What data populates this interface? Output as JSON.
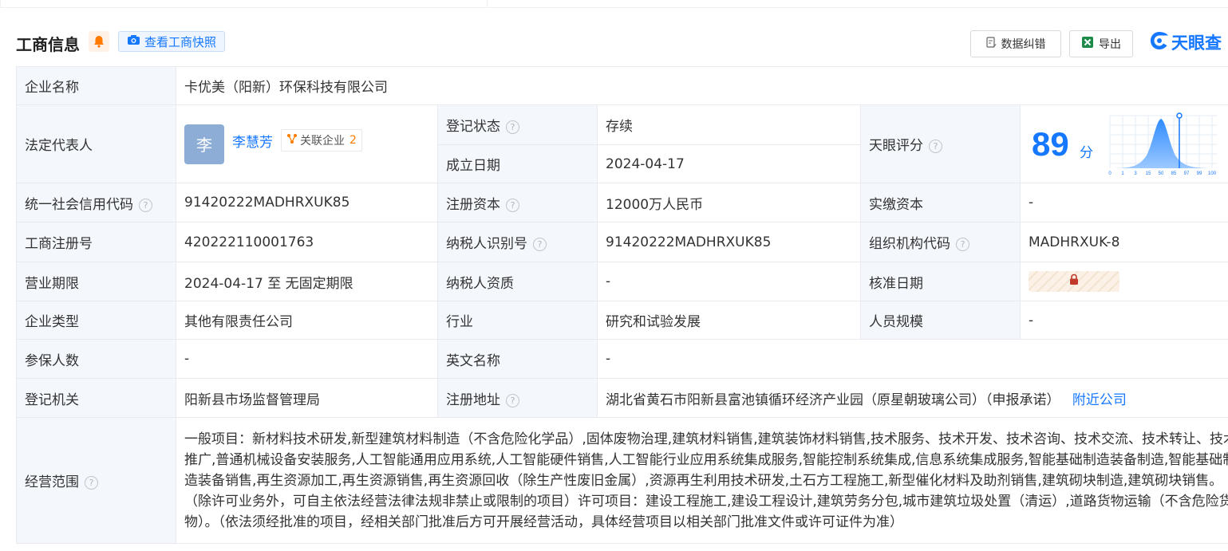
{
  "header": {
    "title": "工商信息",
    "snapshot_label": "查看工商快照",
    "correction_label": "数据纠错",
    "export_label": "导出",
    "logo_text": "天眼查"
  },
  "icons": {
    "bell": "bell-icon",
    "camera": "camera-icon",
    "correction": "document-edit-icon",
    "excel": "excel-icon",
    "logo": "tianyancha-logo-icon",
    "help": "question-circle-icon",
    "related": "network-icon",
    "lock": "lock-icon"
  },
  "colors": {
    "accent": "#1677ff",
    "label_bg": "#f4f7fc",
    "status_green": "#29a36a",
    "orange": "#ff7a00"
  },
  "rows": {
    "company_name": {
      "label": "企业名称",
      "value": "卡优美（阳新）环保科技有限公司"
    },
    "legal_rep": {
      "label": "法定代表人",
      "avatar_char": "李",
      "name": "李慧芳",
      "related_label": "关联企业",
      "related_count": "2"
    },
    "reg_status": {
      "label": "登记状态",
      "value": "存续"
    },
    "found_date": {
      "label": "成立日期",
      "value": "2024-04-17"
    },
    "tianyan_score": {
      "label": "天眼评分",
      "score": "89",
      "unit": "分",
      "axis_ticks": [
        "0",
        "1",
        "3",
        "15",
        "50",
        "85",
        "97",
        "99",
        "100"
      ]
    },
    "credit_code": {
      "label": "统一社会信用代码",
      "value": "91420222MADHRXUK85"
    },
    "reg_capital": {
      "label": "注册资本",
      "value": "12000万人民币"
    },
    "paid_capital": {
      "label": "实缴资本",
      "value": "-"
    },
    "reg_number": {
      "label": "工商注册号",
      "value": "420222110001763"
    },
    "taxpayer_id": {
      "label": "纳税人识别号",
      "value": "91420222MADHRXUK85"
    },
    "org_code": {
      "label": "组织机构代码",
      "value": "MADHRXUK-8"
    },
    "biz_term": {
      "label": "营业期限",
      "value": "2024-04-17 至 无固定期限"
    },
    "taxpayer_qual": {
      "label": "纳税人资质",
      "value": "-"
    },
    "approval_date": {
      "label": "核准日期"
    },
    "company_type": {
      "label": "企业类型",
      "value": "其他有限责任公司"
    },
    "industry": {
      "label": "行业",
      "value": "研究和试验发展"
    },
    "staff_size": {
      "label": "人员规模",
      "value": "-"
    },
    "insured": {
      "label": "参保人数",
      "value": "-"
    },
    "english_name": {
      "label": "英文名称",
      "value": "-"
    },
    "reg_authority": {
      "label": "登记机关",
      "value": "阳新县市场监督管理局"
    },
    "reg_address": {
      "label": "注册地址",
      "value": "湖北省黄石市阳新县富池镇循环经济产业园（原星朝玻璃公司）（申报承诺）",
      "nearby_label": "附近公司"
    },
    "biz_scope": {
      "label": "经营范围",
      "value": "一般项目：新材料技术研发,新型建筑材料制造（不含危险化学品）,固体废物治理,建筑材料销售,建筑装饰材料销售,技术服务、技术开发、技术咨询、技术交流、技术转让、技术推广,普通机械设备安装服务,人工智能通用应用系统,人工智能硬件销售,人工智能行业应用系统集成服务,智能控制系统集成,信息系统集成服务,智能基础制造装备制造,智能基础制造装备销售,再生资源加工,再生资源销售,再生资源回收（除生产性废旧金属）,资源再生利用技术研发,土石方工程施工,新型催化材料及助剂销售,建筑砌块制造,建筑砌块销售。（除许可业务外，可自主依法经营法律法规非禁止或限制的项目）许可项目：建设工程施工,建设工程设计,建筑劳务分包,城市建筑垃圾处置（清运）,道路货物运输（不含危险货物）。（依法须经批准的项目，经相关部门批准后方可开展经营活动，具体经营项目以相关部门批准文件或许可证件为准）"
    }
  }
}
